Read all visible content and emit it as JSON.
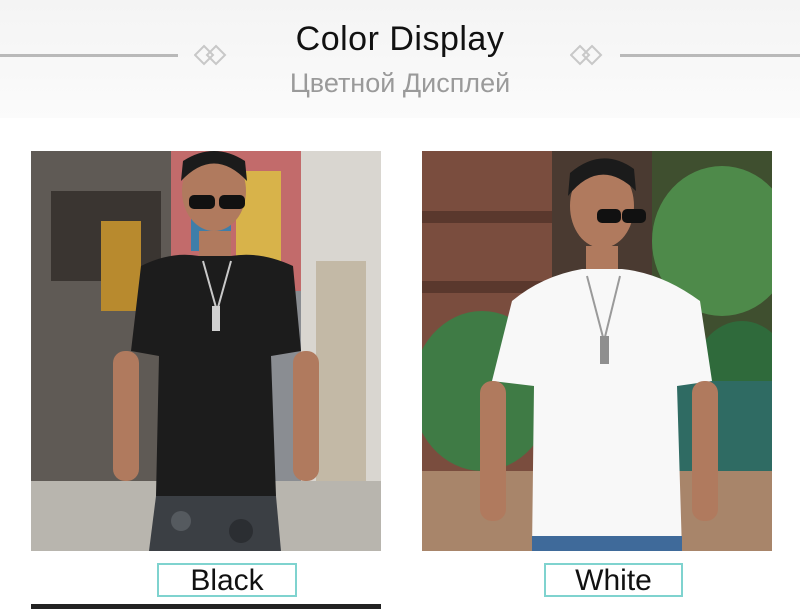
{
  "header": {
    "title": "Color Display",
    "subtitle": "Цветной Дисплей"
  },
  "variants": [
    {
      "label": "Black",
      "shirt_color": "#1c1c1c"
    },
    {
      "label": "White",
      "shirt_color": "#f8f8f8"
    }
  ],
  "colors": {
    "label_border": "#7fd3cf",
    "title": "#111111",
    "subtitle": "#9a9a9a",
    "rule": "#b9b9b9"
  }
}
